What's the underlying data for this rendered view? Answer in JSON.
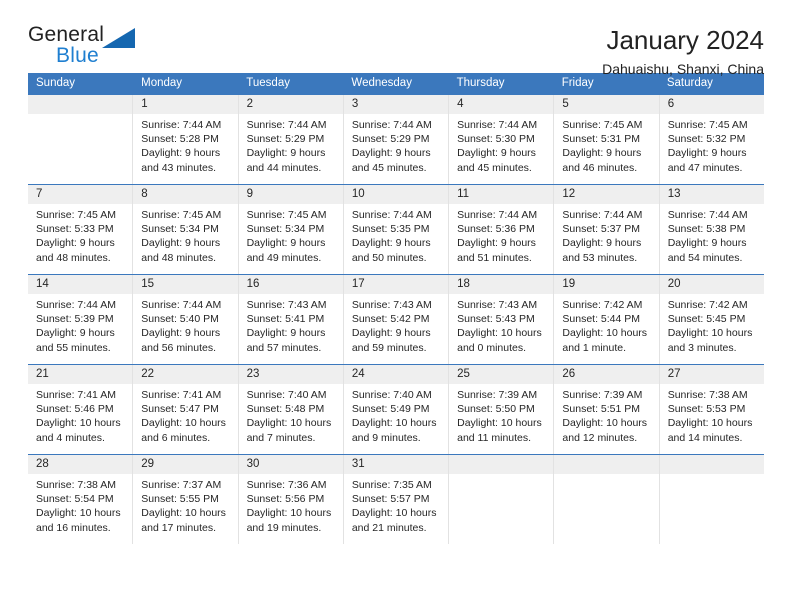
{
  "brand": {
    "name_part1": "General",
    "name_part2": "Blue",
    "triangle_color": "#1567b0"
  },
  "header": {
    "title": "January 2024",
    "subtitle": "Dahuaishu, Shanxi, China"
  },
  "theme": {
    "header_blue": "#3b78bd",
    "day_band_gray": "#efefef",
    "grid_border": "#e2e2e2"
  },
  "weekdays": [
    "Sunday",
    "Monday",
    "Tuesday",
    "Wednesday",
    "Thursday",
    "Friday",
    "Saturday"
  ],
  "weeks": [
    [
      {
        "day": "",
        "sunrise": "",
        "sunset": "",
        "daylight_line1": "",
        "daylight_line2": ""
      },
      {
        "day": "1",
        "sunrise": "Sunrise: 7:44 AM",
        "sunset": "Sunset: 5:28 PM",
        "daylight_line1": "Daylight: 9 hours",
        "daylight_line2": "and 43 minutes."
      },
      {
        "day": "2",
        "sunrise": "Sunrise: 7:44 AM",
        "sunset": "Sunset: 5:29 PM",
        "daylight_line1": "Daylight: 9 hours",
        "daylight_line2": "and 44 minutes."
      },
      {
        "day": "3",
        "sunrise": "Sunrise: 7:44 AM",
        "sunset": "Sunset: 5:29 PM",
        "daylight_line1": "Daylight: 9 hours",
        "daylight_line2": "and 45 minutes."
      },
      {
        "day": "4",
        "sunrise": "Sunrise: 7:44 AM",
        "sunset": "Sunset: 5:30 PM",
        "daylight_line1": "Daylight: 9 hours",
        "daylight_line2": "and 45 minutes."
      },
      {
        "day": "5",
        "sunrise": "Sunrise: 7:45 AM",
        "sunset": "Sunset: 5:31 PM",
        "daylight_line1": "Daylight: 9 hours",
        "daylight_line2": "and 46 minutes."
      },
      {
        "day": "6",
        "sunrise": "Sunrise: 7:45 AM",
        "sunset": "Sunset: 5:32 PM",
        "daylight_line1": "Daylight: 9 hours",
        "daylight_line2": "and 47 minutes."
      }
    ],
    [
      {
        "day": "7",
        "sunrise": "Sunrise: 7:45 AM",
        "sunset": "Sunset: 5:33 PM",
        "daylight_line1": "Daylight: 9 hours",
        "daylight_line2": "and 48 minutes."
      },
      {
        "day": "8",
        "sunrise": "Sunrise: 7:45 AM",
        "sunset": "Sunset: 5:34 PM",
        "daylight_line1": "Daylight: 9 hours",
        "daylight_line2": "and 48 minutes."
      },
      {
        "day": "9",
        "sunrise": "Sunrise: 7:45 AM",
        "sunset": "Sunset: 5:34 PM",
        "daylight_line1": "Daylight: 9 hours",
        "daylight_line2": "and 49 minutes."
      },
      {
        "day": "10",
        "sunrise": "Sunrise: 7:44 AM",
        "sunset": "Sunset: 5:35 PM",
        "daylight_line1": "Daylight: 9 hours",
        "daylight_line2": "and 50 minutes."
      },
      {
        "day": "11",
        "sunrise": "Sunrise: 7:44 AM",
        "sunset": "Sunset: 5:36 PM",
        "daylight_line1": "Daylight: 9 hours",
        "daylight_line2": "and 51 minutes."
      },
      {
        "day": "12",
        "sunrise": "Sunrise: 7:44 AM",
        "sunset": "Sunset: 5:37 PM",
        "daylight_line1": "Daylight: 9 hours",
        "daylight_line2": "and 53 minutes."
      },
      {
        "day": "13",
        "sunrise": "Sunrise: 7:44 AM",
        "sunset": "Sunset: 5:38 PM",
        "daylight_line1": "Daylight: 9 hours",
        "daylight_line2": "and 54 minutes."
      }
    ],
    [
      {
        "day": "14",
        "sunrise": "Sunrise: 7:44 AM",
        "sunset": "Sunset: 5:39 PM",
        "daylight_line1": "Daylight: 9 hours",
        "daylight_line2": "and 55 minutes."
      },
      {
        "day": "15",
        "sunrise": "Sunrise: 7:44 AM",
        "sunset": "Sunset: 5:40 PM",
        "daylight_line1": "Daylight: 9 hours",
        "daylight_line2": "and 56 minutes."
      },
      {
        "day": "16",
        "sunrise": "Sunrise: 7:43 AM",
        "sunset": "Sunset: 5:41 PM",
        "daylight_line1": "Daylight: 9 hours",
        "daylight_line2": "and 57 minutes."
      },
      {
        "day": "17",
        "sunrise": "Sunrise: 7:43 AM",
        "sunset": "Sunset: 5:42 PM",
        "daylight_line1": "Daylight: 9 hours",
        "daylight_line2": "and 59 minutes."
      },
      {
        "day": "18",
        "sunrise": "Sunrise: 7:43 AM",
        "sunset": "Sunset: 5:43 PM",
        "daylight_line1": "Daylight: 10 hours",
        "daylight_line2": "and 0 minutes."
      },
      {
        "day": "19",
        "sunrise": "Sunrise: 7:42 AM",
        "sunset": "Sunset: 5:44 PM",
        "daylight_line1": "Daylight: 10 hours",
        "daylight_line2": "and 1 minute."
      },
      {
        "day": "20",
        "sunrise": "Sunrise: 7:42 AM",
        "sunset": "Sunset: 5:45 PM",
        "daylight_line1": "Daylight: 10 hours",
        "daylight_line2": "and 3 minutes."
      }
    ],
    [
      {
        "day": "21",
        "sunrise": "Sunrise: 7:41 AM",
        "sunset": "Sunset: 5:46 PM",
        "daylight_line1": "Daylight: 10 hours",
        "daylight_line2": "and 4 minutes."
      },
      {
        "day": "22",
        "sunrise": "Sunrise: 7:41 AM",
        "sunset": "Sunset: 5:47 PM",
        "daylight_line1": "Daylight: 10 hours",
        "daylight_line2": "and 6 minutes."
      },
      {
        "day": "23",
        "sunrise": "Sunrise: 7:40 AM",
        "sunset": "Sunset: 5:48 PM",
        "daylight_line1": "Daylight: 10 hours",
        "daylight_line2": "and 7 minutes."
      },
      {
        "day": "24",
        "sunrise": "Sunrise: 7:40 AM",
        "sunset": "Sunset: 5:49 PM",
        "daylight_line1": "Daylight: 10 hours",
        "daylight_line2": "and 9 minutes."
      },
      {
        "day": "25",
        "sunrise": "Sunrise: 7:39 AM",
        "sunset": "Sunset: 5:50 PM",
        "daylight_line1": "Daylight: 10 hours",
        "daylight_line2": "and 11 minutes."
      },
      {
        "day": "26",
        "sunrise": "Sunrise: 7:39 AM",
        "sunset": "Sunset: 5:51 PM",
        "daylight_line1": "Daylight: 10 hours",
        "daylight_line2": "and 12 minutes."
      },
      {
        "day": "27",
        "sunrise": "Sunrise: 7:38 AM",
        "sunset": "Sunset: 5:53 PM",
        "daylight_line1": "Daylight: 10 hours",
        "daylight_line2": "and 14 minutes."
      }
    ],
    [
      {
        "day": "28",
        "sunrise": "Sunrise: 7:38 AM",
        "sunset": "Sunset: 5:54 PM",
        "daylight_line1": "Daylight: 10 hours",
        "daylight_line2": "and 16 minutes."
      },
      {
        "day": "29",
        "sunrise": "Sunrise: 7:37 AM",
        "sunset": "Sunset: 5:55 PM",
        "daylight_line1": "Daylight: 10 hours",
        "daylight_line2": "and 17 minutes."
      },
      {
        "day": "30",
        "sunrise": "Sunrise: 7:36 AM",
        "sunset": "Sunset: 5:56 PM",
        "daylight_line1": "Daylight: 10 hours",
        "daylight_line2": "and 19 minutes."
      },
      {
        "day": "31",
        "sunrise": "Sunrise: 7:35 AM",
        "sunset": "Sunset: 5:57 PM",
        "daylight_line1": "Daylight: 10 hours",
        "daylight_line2": "and 21 minutes."
      },
      {
        "day": "",
        "sunrise": "",
        "sunset": "",
        "daylight_line1": "",
        "daylight_line2": ""
      },
      {
        "day": "",
        "sunrise": "",
        "sunset": "",
        "daylight_line1": "",
        "daylight_line2": ""
      },
      {
        "day": "",
        "sunrise": "",
        "sunset": "",
        "daylight_line1": "",
        "daylight_line2": ""
      }
    ]
  ]
}
